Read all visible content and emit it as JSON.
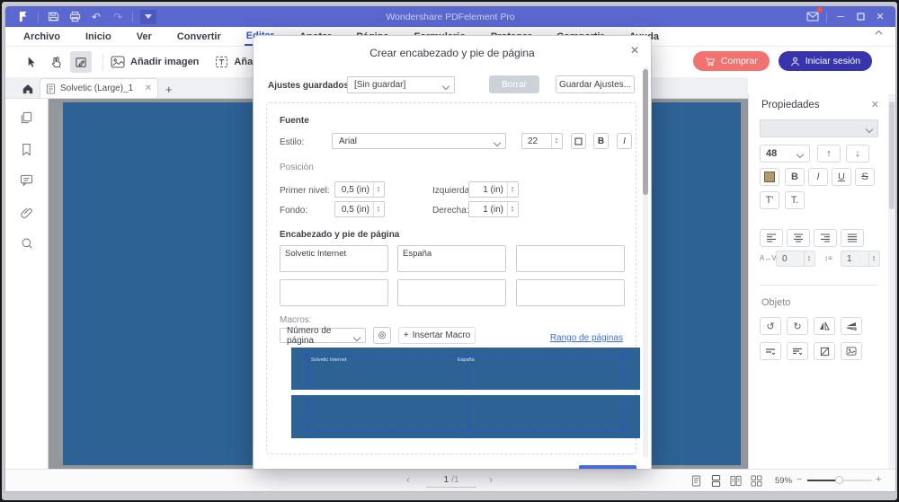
{
  "titlebar": {
    "title": "Wondershare PDFelement Pro"
  },
  "menu": {
    "items": [
      "Archivo",
      "Inicio",
      "Ver",
      "Convertir",
      "Editar",
      "Anotar",
      "Página",
      "Formulario",
      "Proteger",
      "Compartir",
      "Ayuda"
    ],
    "active": "Editar"
  },
  "toolbar": {
    "add_image": "Añadir imagen",
    "add_text": "Añadir texto",
    "buy": "Comprar",
    "sign_in": "Iniciar sesión"
  },
  "tabs": {
    "active": "Solvetic (Large)_1"
  },
  "dialog": {
    "title": "Crear encabezado y pie de página",
    "saved_settings_label": "Ajustes guardados:",
    "saved_settings_value": "[Sin guardar]",
    "delete_button": "Borrar",
    "save_settings_button": "Guardar Ajustes...",
    "font": {
      "section": "Fuente",
      "style_label": "Estilo:",
      "style_value": "Arial",
      "size": "22",
      "bold": "B",
      "italic": "I"
    },
    "position": {
      "section": "Posición",
      "first_label": "Primer nivel:",
      "first_value": "0,5 (in)",
      "left_label": "Izquierda:",
      "left_value": "1 (in)",
      "bottom_label": "Fondo:",
      "bottom_value": "0,5 (in)",
      "right_label": "Derecha:",
      "right_value": "1 (in)"
    },
    "header_footer": {
      "section": "Encabezado y pie de página",
      "cells": [
        "Solvetic Internet",
        "España",
        "",
        "",
        "",
        ""
      ]
    },
    "macros": {
      "label": "Macros:",
      "selected": "Número de página",
      "insert_button": "Insertar Macro",
      "page_range_link": "Rango de páginas"
    },
    "preview": {
      "header_left": "Solvetic Internet",
      "header_center": "España"
    }
  },
  "properties": {
    "title": "Propiedades",
    "font_size": "48",
    "bold": "B",
    "italic": "I",
    "underline": "U",
    "strike": "S",
    "superscript": "T'",
    "subscript": "T.",
    "spacing_value": "0",
    "line_spacing_value": "1",
    "object_section": "Objeto"
  },
  "statusbar": {
    "page_value": "1",
    "page_total": "/1",
    "zoom_percent": "59%"
  },
  "colors": {
    "titlebar_blue": "#5a68cf",
    "accent_blue": "#3558c8",
    "page_blue": "#2d6394",
    "buy_coral": "#f3716e",
    "signin_indigo": "#3834ad",
    "link_blue": "#3b6fd6",
    "preview_guide_blue": "#2b4de0"
  }
}
